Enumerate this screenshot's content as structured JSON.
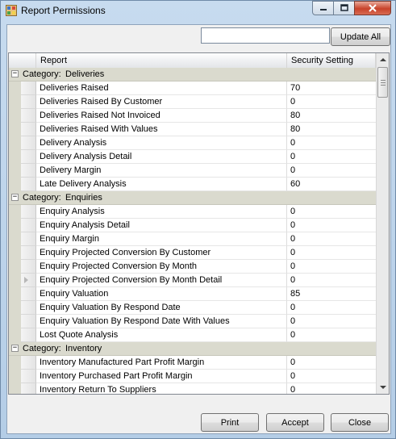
{
  "window": {
    "title": "Report Permissions"
  },
  "toolbar": {
    "search_value": "",
    "update_label": "Update All"
  },
  "grid": {
    "columns": {
      "report": "Report",
      "security": "Security Setting"
    },
    "rows": [
      {
        "type": "category",
        "prefix": "Category:",
        "name": "Deliveries"
      },
      {
        "type": "item",
        "report": "Deliveries Raised",
        "value": "70"
      },
      {
        "type": "item",
        "report": "Deliveries Raised By Customer",
        "value": "0"
      },
      {
        "type": "item",
        "report": "Deliveries Raised Not Invoiced",
        "value": "80"
      },
      {
        "type": "item",
        "report": "Deliveries Raised With Values",
        "value": "80"
      },
      {
        "type": "item",
        "report": "Delivery Analysis",
        "value": "0"
      },
      {
        "type": "item",
        "report": "Delivery Analysis Detail",
        "value": "0"
      },
      {
        "type": "item",
        "report": "Delivery Margin",
        "value": "0"
      },
      {
        "type": "item",
        "report": "Late Delivery Analysis",
        "value": "60"
      },
      {
        "type": "category",
        "prefix": "Category:",
        "name": "Enquiries"
      },
      {
        "type": "item",
        "report": "Enquiry Analysis",
        "value": "0"
      },
      {
        "type": "item",
        "report": "Enquiry Analysis Detail",
        "value": "0"
      },
      {
        "type": "item",
        "report": "Enquiry Margin",
        "value": "0"
      },
      {
        "type": "item",
        "report": "Enquiry Projected Conversion By Customer",
        "value": "0"
      },
      {
        "type": "item",
        "report": "Enquiry Projected Conversion By Month",
        "value": "0"
      },
      {
        "type": "item",
        "report": "Enquiry Projected Conversion By Month Detail",
        "value": "0",
        "current": true
      },
      {
        "type": "item",
        "report": "Enquiry Valuation",
        "value": "85"
      },
      {
        "type": "item",
        "report": "Enquiry Valuation By Respond Date",
        "value": "0"
      },
      {
        "type": "item",
        "report": "Enquiry Valuation By Respond Date With Values",
        "value": "0"
      },
      {
        "type": "item",
        "report": "Lost Quote Analysis",
        "value": "0"
      },
      {
        "type": "category",
        "prefix": "Category:",
        "name": "Inventory"
      },
      {
        "type": "item",
        "report": "Inventory Manufactured Part Profit Margin",
        "value": "0"
      },
      {
        "type": "item",
        "report": "Inventory Purchased Part Profit Margin",
        "value": "0"
      },
      {
        "type": "item",
        "report": "Inventory Return To Suppliers",
        "value": "0"
      }
    ]
  },
  "footer": {
    "print_label": "Print",
    "accept_label": "Accept",
    "close_label": "Close"
  },
  "colors": {
    "category_bg": "#dadace",
    "window_frame": "#b4cde6",
    "close_red": "#c8432b"
  }
}
